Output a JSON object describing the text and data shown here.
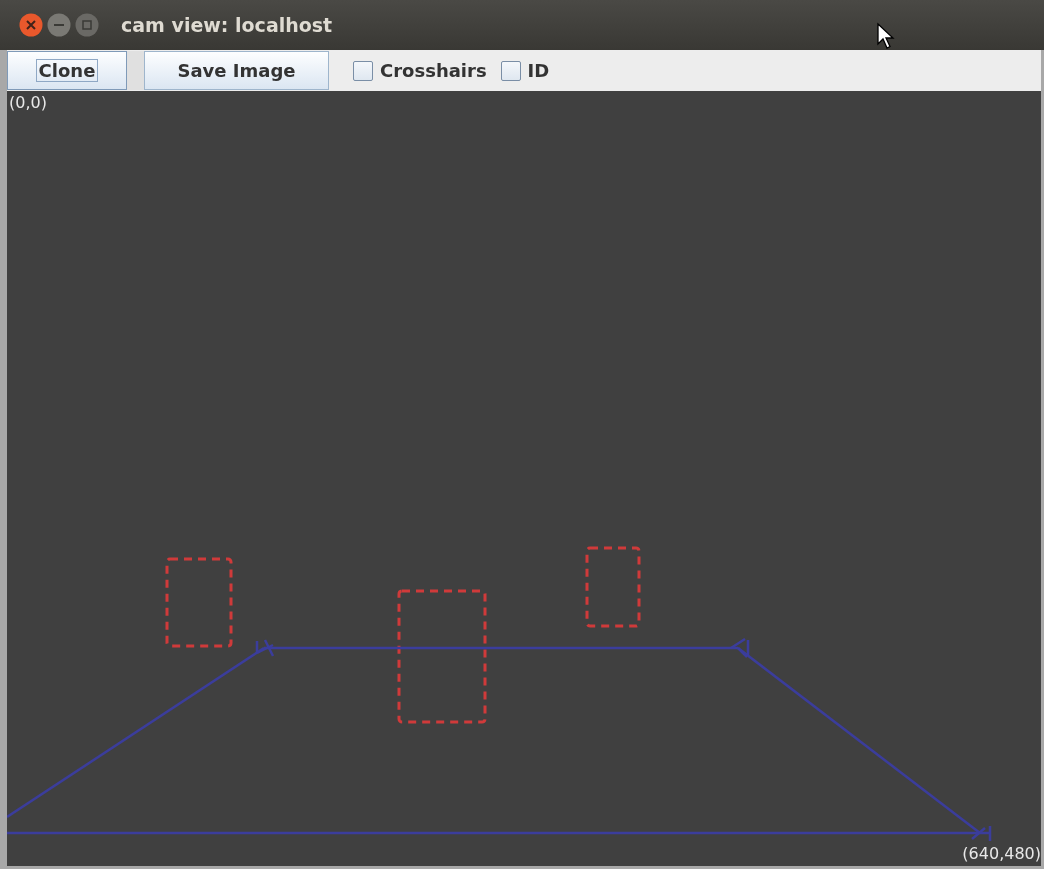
{
  "window": {
    "title": "cam view: localhost"
  },
  "toolbar": {
    "buttons": [
      {
        "label": "Clone",
        "focused": true
      },
      {
        "label": "Save Image",
        "focused": false
      }
    ],
    "checkboxes": [
      {
        "label": "Crosshairs",
        "checked": false
      },
      {
        "label": "ID",
        "checked": false
      }
    ]
  },
  "view": {
    "origin_label": "(0,0)",
    "extent_label": "(640,480)"
  }
}
